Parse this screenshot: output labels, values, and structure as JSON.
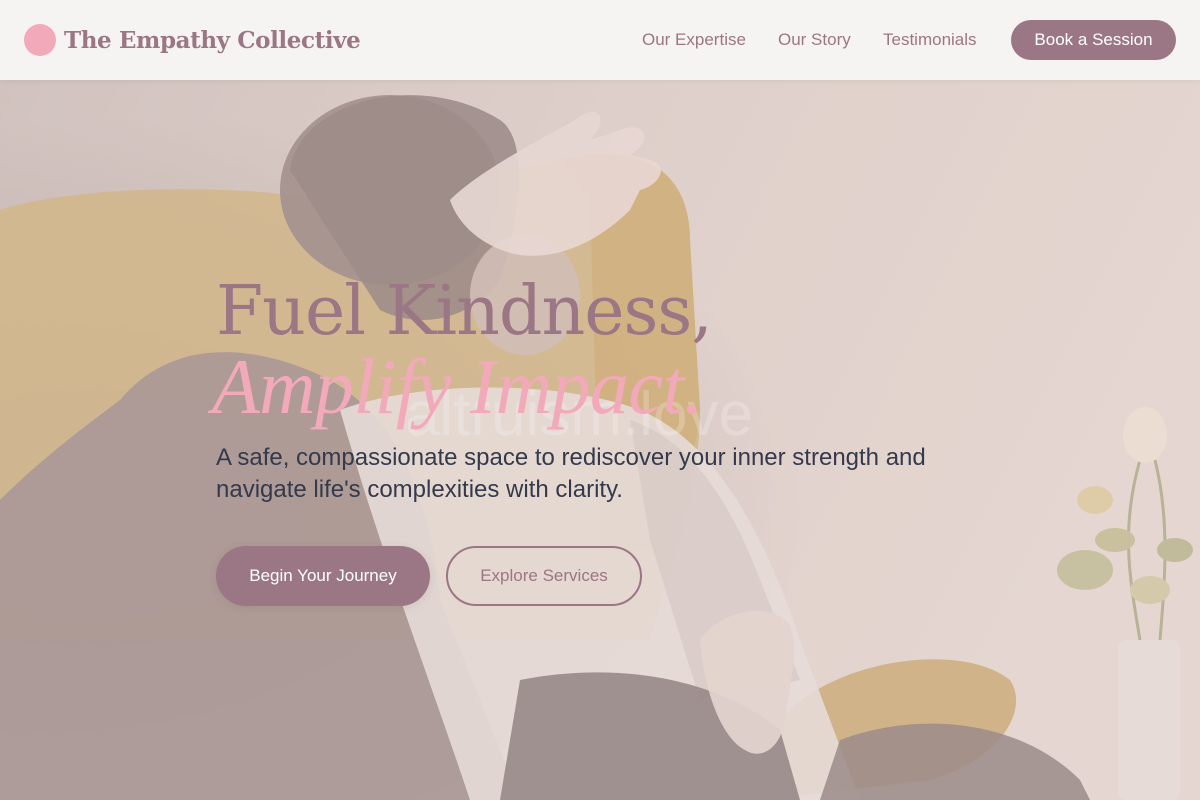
{
  "header": {
    "brand_name": "The Empathy Collective",
    "nav": {
      "expertise": "Our Expertise",
      "story": "Our Story",
      "testimonials": "Testimonials"
    },
    "cta_label": "Book a Session"
  },
  "hero": {
    "headline_line1": "Fuel Kindness,",
    "headline_line2": "Amplify Impact.",
    "watermark": "altruism.love",
    "subtitle": "A safe, compassionate space to rediscover your inner strength and navigate life's complexities with clarity.",
    "primary_button": "Begin Your Journey",
    "secondary_button": "Explore Services",
    "background_image": "woman-in-armchair-photo"
  },
  "colors": {
    "brand": "#9b7684",
    "accent_pink": "#f2a9b9",
    "header_bg": "#f6f4f3",
    "body_text": "#343a4c"
  }
}
